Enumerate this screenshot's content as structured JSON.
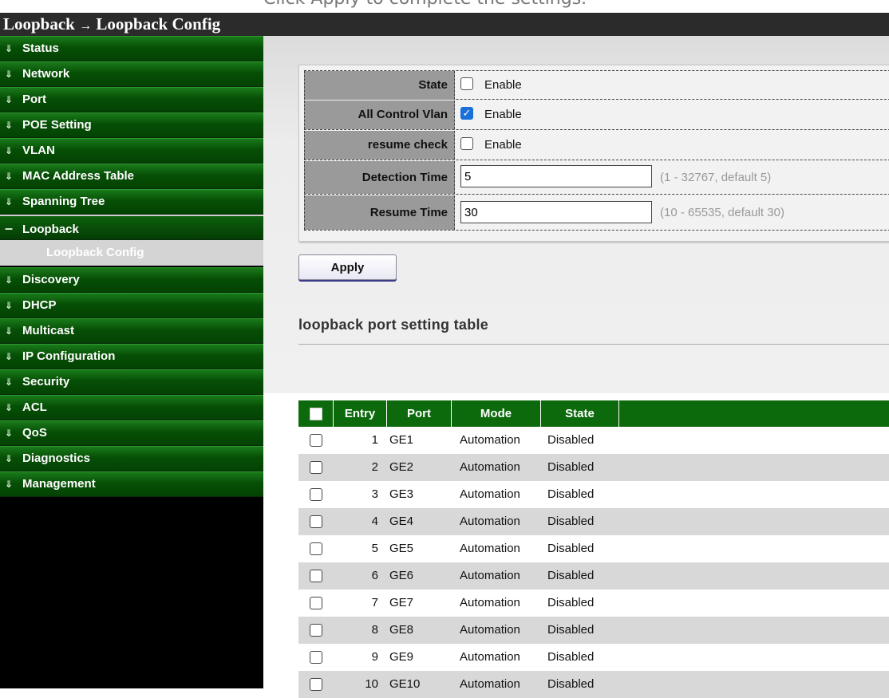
{
  "top_hint": "Click Apply to complete the settings.",
  "breadcrumb": {
    "parent": "Loopback",
    "arrow": "→",
    "current": "Loopback Config"
  },
  "sidebar": {
    "items": [
      {
        "label": "Status",
        "icon": "double-chevron-down-icon"
      },
      {
        "label": "Network",
        "icon": "double-chevron-down-icon"
      },
      {
        "label": "Port",
        "icon": "double-chevron-down-icon"
      },
      {
        "label": "POE Setting",
        "icon": "double-chevron-down-icon"
      },
      {
        "label": "VLAN",
        "icon": "double-chevron-down-icon"
      },
      {
        "label": "MAC Address Table",
        "icon": "double-chevron-down-icon"
      },
      {
        "label": "Spanning Tree",
        "icon": "double-chevron-down-icon"
      },
      {
        "label": "Loopback",
        "icon": "minus-icon",
        "open": true
      },
      {
        "label": "Discovery",
        "icon": "double-chevron-down-icon"
      },
      {
        "label": "DHCP",
        "icon": "double-chevron-down-icon"
      },
      {
        "label": "Multicast",
        "icon": "double-chevron-down-icon"
      },
      {
        "label": "IP Configuration",
        "icon": "double-chevron-down-icon"
      },
      {
        "label": "Security",
        "icon": "double-chevron-down-icon"
      },
      {
        "label": "ACL",
        "icon": "double-chevron-down-icon"
      },
      {
        "label": "QoS",
        "icon": "double-chevron-down-icon"
      },
      {
        "label": "Diagnostics",
        "icon": "double-chevron-down-icon"
      },
      {
        "label": "Management",
        "icon": "double-chevron-down-icon"
      }
    ],
    "sub_item": "Loopback Config"
  },
  "config": {
    "state": {
      "label": "State",
      "option": "Enable",
      "checked": false
    },
    "all_control_vlan": {
      "label": "All Control Vlan",
      "option": "Enable",
      "checked": true
    },
    "resume_check": {
      "label": "resume check",
      "option": "Enable",
      "checked": false
    },
    "detection_time": {
      "label": "Detection Time",
      "value": "5",
      "hint": "(1 - 32767, default 5)"
    },
    "resume_time": {
      "label": "Resume Time",
      "value": "30",
      "hint": "(10 - 65535, default 30)"
    }
  },
  "apply_label": "Apply",
  "table": {
    "title": "loopback port setting table",
    "columns": [
      "Entry",
      "Port",
      "Mode",
      "State"
    ],
    "rows": [
      {
        "entry": "1",
        "port": "GE1",
        "mode": "Automation",
        "state": "Disabled"
      },
      {
        "entry": "2",
        "port": "GE2",
        "mode": "Automation",
        "state": "Disabled"
      },
      {
        "entry": "3",
        "port": "GE3",
        "mode": "Automation",
        "state": "Disabled"
      },
      {
        "entry": "4",
        "port": "GE4",
        "mode": "Automation",
        "state": "Disabled"
      },
      {
        "entry": "5",
        "port": "GE5",
        "mode": "Automation",
        "state": "Disabled"
      },
      {
        "entry": "6",
        "port": "GE6",
        "mode": "Automation",
        "state": "Disabled"
      },
      {
        "entry": "7",
        "port": "GE7",
        "mode": "Automation",
        "state": "Disabled"
      },
      {
        "entry": "8",
        "port": "GE8",
        "mode": "Automation",
        "state": "Disabled"
      },
      {
        "entry": "9",
        "port": "GE9",
        "mode": "Automation",
        "state": "Disabled"
      },
      {
        "entry": "10",
        "port": "GE10",
        "mode": "Automation",
        "state": "Disabled"
      }
    ]
  },
  "colors": {
    "menu_green": "#064f06",
    "header_green": "#0c6a0c",
    "checkbox_blue": "#1a6fd8"
  }
}
